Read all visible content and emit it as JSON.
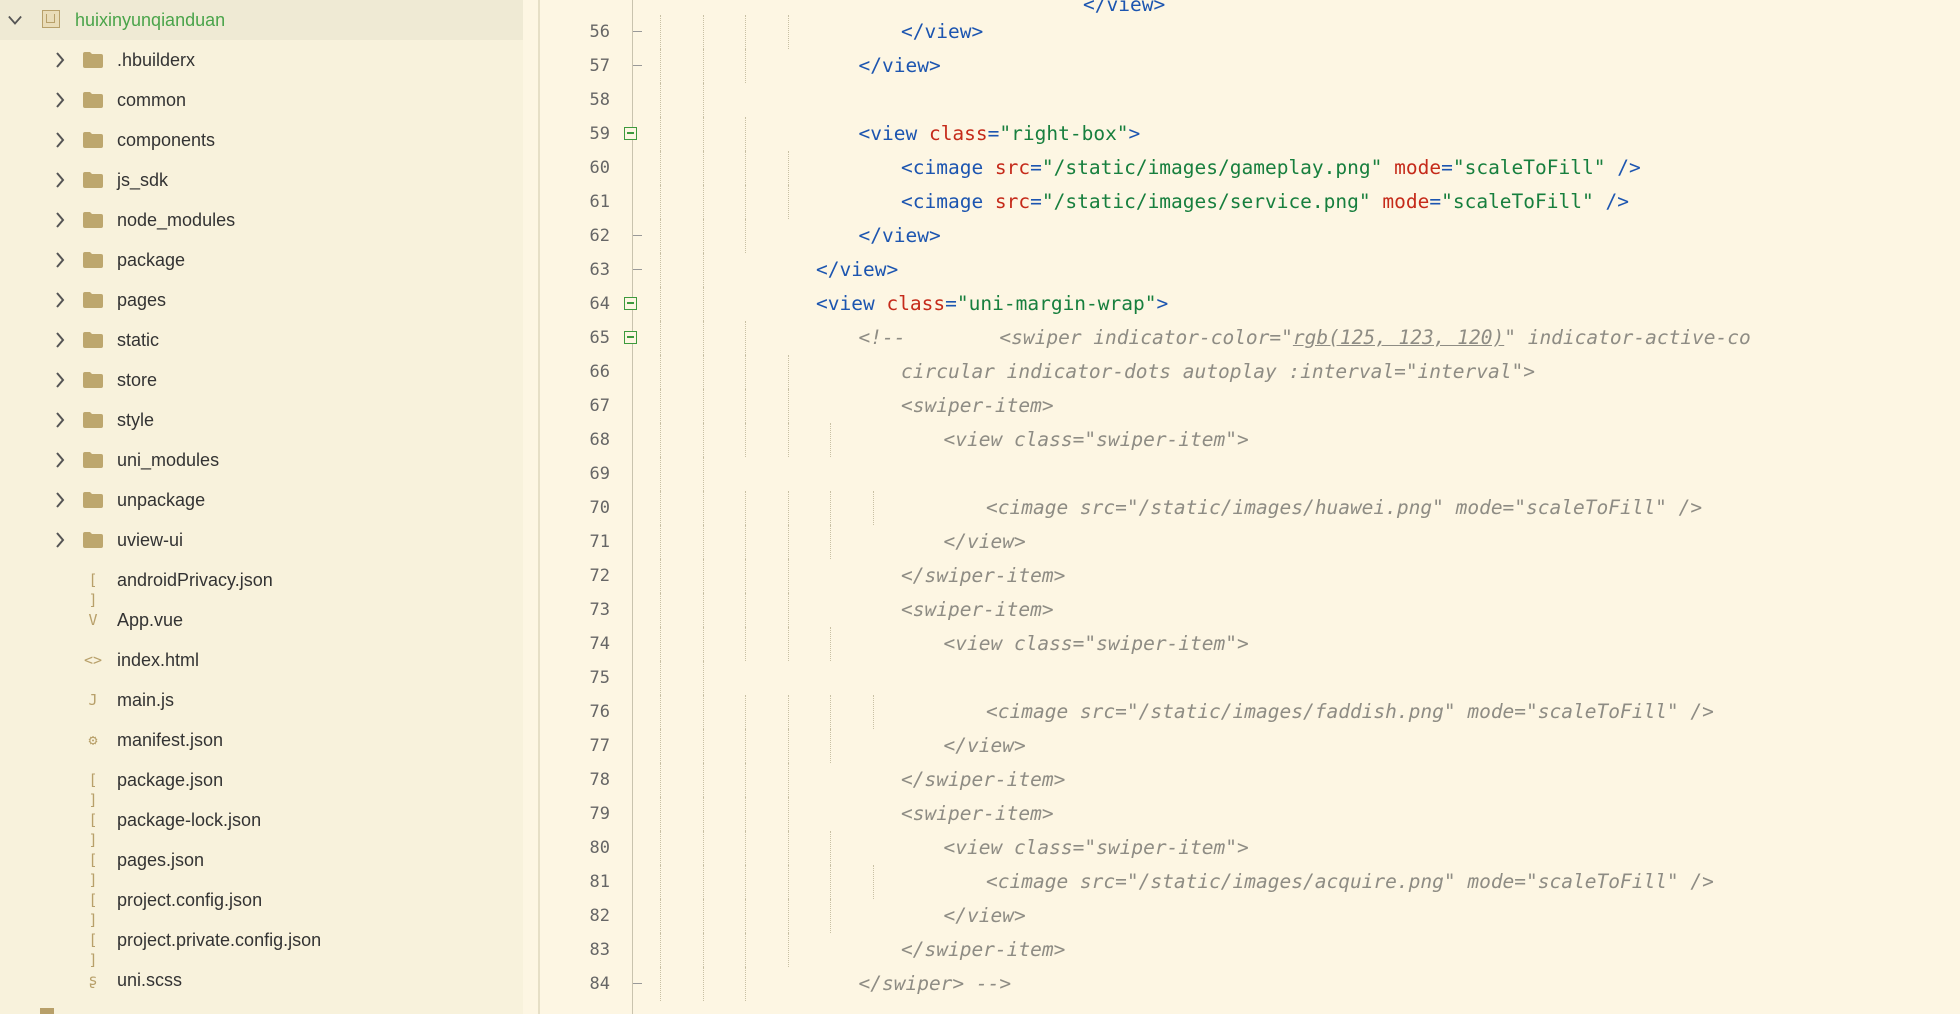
{
  "project": {
    "name": "huixinyunqianduan",
    "folders": [
      ".hbuilderx",
      "common",
      "components",
      "js_sdk",
      "node_modules",
      "package",
      "pages",
      "static",
      "store",
      "style",
      "uni_modules",
      "unpackage",
      "uview-ui"
    ],
    "files": [
      {
        "name": "androidPrivacy.json",
        "icon": "json-brackets-icon",
        "glyph": "[ ]"
      },
      {
        "name": "App.vue",
        "icon": "vue-file-icon",
        "glyph": "V"
      },
      {
        "name": "index.html",
        "icon": "html-file-icon",
        "glyph": "<>"
      },
      {
        "name": "main.js",
        "icon": "js-file-icon",
        "glyph": "J"
      },
      {
        "name": "manifest.json",
        "icon": "manifest-gear-icon",
        "glyph": "⚙"
      },
      {
        "name": "package.json",
        "icon": "json-brackets-icon",
        "glyph": "[ ]"
      },
      {
        "name": "package-lock.json",
        "icon": "json-brackets-icon",
        "glyph": "[ ]"
      },
      {
        "name": "pages.json",
        "icon": "json-brackets-icon",
        "glyph": "[ ]"
      },
      {
        "name": "project.config.json",
        "icon": "json-brackets-icon",
        "glyph": "[ ]"
      },
      {
        "name": "project.private.config.json",
        "icon": "json-brackets-icon",
        "glyph": "[ ]"
      },
      {
        "name": "uni.scss",
        "icon": "scss-file-icon",
        "glyph": "ʂ"
      }
    ]
  },
  "colors": {
    "background": "#fdf6e3",
    "tag": "#1c55b0",
    "attribute": "#c52a1a",
    "string": "#177f3e",
    "comment": "#8e8c84",
    "project_name": "#4aa44a"
  },
  "editor": {
    "lines": [
      {
        "n": "56",
        "indent": 2,
        "fold": "end",
        "tokens": [
          [
            "tag",
            "</view>"
          ]
        ]
      },
      {
        "n": "57",
        "indent": 1,
        "fold": "end",
        "tokens": [
          [
            "tag",
            "</view>"
          ]
        ]
      },
      {
        "n": "58",
        "indent": 0,
        "fold": "",
        "tokens": []
      },
      {
        "n": "59",
        "indent": 1,
        "fold": "open",
        "tokens": [
          [
            "tag",
            "<view "
          ],
          [
            "attr",
            "class"
          ],
          [
            "punc",
            "="
          ],
          [
            "str",
            "\"right-box\""
          ],
          [
            "tag",
            ">"
          ]
        ]
      },
      {
        "n": "60",
        "indent": 2,
        "fold": "",
        "tokens": [
          [
            "tag",
            "<cimage "
          ],
          [
            "attr",
            "src"
          ],
          [
            "punc",
            "="
          ],
          [
            "str",
            "\"/static/images/gameplay.png\""
          ],
          [
            "plain",
            " "
          ],
          [
            "attr",
            "mode"
          ],
          [
            "punc",
            "="
          ],
          [
            "str",
            "\"scaleToFill\""
          ],
          [
            "tag",
            " />"
          ]
        ]
      },
      {
        "n": "61",
        "indent": 2,
        "fold": "",
        "tokens": [
          [
            "tag",
            "<cimage "
          ],
          [
            "attr",
            "src"
          ],
          [
            "punc",
            "="
          ],
          [
            "str",
            "\"/static/images/service.png\""
          ],
          [
            "plain",
            " "
          ],
          [
            "attr",
            "mode"
          ],
          [
            "punc",
            "="
          ],
          [
            "str",
            "\"scaleToFill\""
          ],
          [
            "tag",
            " />"
          ]
        ]
      },
      {
        "n": "62",
        "indent": 1,
        "fold": "end",
        "tokens": [
          [
            "tag",
            "</view>"
          ]
        ]
      },
      {
        "n": "63",
        "indent": 0,
        "fold": "end",
        "tokens": [
          [
            "tag",
            "</view>"
          ]
        ]
      },
      {
        "n": "64",
        "indent": 0,
        "fold": "open",
        "tokens": [
          [
            "tag",
            "<view "
          ],
          [
            "attr",
            "class"
          ],
          [
            "punc",
            "="
          ],
          [
            "str",
            "\"uni-margin-wrap\""
          ],
          [
            "tag",
            ">"
          ]
        ]
      },
      {
        "n": "65",
        "indent": 1,
        "fold": "open",
        "tokens": [
          [
            "cmt",
            "<!--        <swiper indicator-color=\""
          ],
          [
            "cmtu",
            "rgb(125, 123, 120)"
          ],
          [
            "cmt",
            "\" indicator-active-co"
          ]
        ]
      },
      {
        "n": "66",
        "indent": 2,
        "fold": "",
        "tokens": [
          [
            "cmt",
            "circular indicator-dots autoplay :interval=\"interval\">"
          ]
        ]
      },
      {
        "n": "67",
        "indent": 2,
        "fold": "",
        "tokens": [
          [
            "cmt",
            "<swiper-item>"
          ]
        ]
      },
      {
        "n": "68",
        "indent": 3,
        "fold": "",
        "tokens": [
          [
            "cmt",
            "<view class=\"swiper-item\">"
          ]
        ]
      },
      {
        "n": "69",
        "indent": 0,
        "fold": "",
        "tokens": []
      },
      {
        "n": "70",
        "indent": 4,
        "fold": "",
        "tokens": [
          [
            "cmt",
            "<cimage src=\"/static/images/huawei.png\" mode=\"scaleToFill\" />"
          ]
        ]
      },
      {
        "n": "71",
        "indent": 3,
        "fold": "",
        "tokens": [
          [
            "cmt",
            "</view>"
          ]
        ]
      },
      {
        "n": "72",
        "indent": 2,
        "fold": "",
        "tokens": [
          [
            "cmt",
            "</swiper-item>"
          ]
        ]
      },
      {
        "n": "73",
        "indent": 2,
        "fold": "",
        "tokens": [
          [
            "cmt",
            "<swiper-item>"
          ]
        ]
      },
      {
        "n": "74",
        "indent": 3,
        "fold": "",
        "tokens": [
          [
            "cmt",
            "<view class=\"swiper-item\">"
          ]
        ]
      },
      {
        "n": "75",
        "indent": 0,
        "fold": "",
        "tokens": []
      },
      {
        "n": "76",
        "indent": 4,
        "fold": "",
        "tokens": [
          [
            "cmt",
            "<cimage src=\"/static/images/faddish.png\" mode=\"scaleToFill\" />"
          ]
        ]
      },
      {
        "n": "77",
        "indent": 3,
        "fold": "",
        "tokens": [
          [
            "cmt",
            "</view>"
          ]
        ]
      },
      {
        "n": "78",
        "indent": 2,
        "fold": "",
        "tokens": [
          [
            "cmt",
            "</swiper-item>"
          ]
        ]
      },
      {
        "n": "79",
        "indent": 2,
        "fold": "",
        "tokens": [
          [
            "cmt",
            "<swiper-item>"
          ]
        ]
      },
      {
        "n": "80",
        "indent": 3,
        "fold": "",
        "tokens": [
          [
            "cmt",
            "<view class=\"swiper-item\">"
          ]
        ]
      },
      {
        "n": "81",
        "indent": 4,
        "fold": "",
        "tokens": [
          [
            "cmt",
            "<cimage src=\"/static/images/acquire.png\" mode=\"scaleToFill\" />"
          ]
        ]
      },
      {
        "n": "82",
        "indent": 3,
        "fold": "",
        "tokens": [
          [
            "cmt",
            "</view>"
          ]
        ]
      },
      {
        "n": "83",
        "indent": 2,
        "fold": "",
        "tokens": [
          [
            "cmt",
            "</swiper-item>"
          ]
        ]
      },
      {
        "n": "84",
        "indent": 1,
        "fold": "end",
        "tokens": [
          [
            "cmt",
            "</swiper> -->"
          ]
        ]
      }
    ]
  }
}
